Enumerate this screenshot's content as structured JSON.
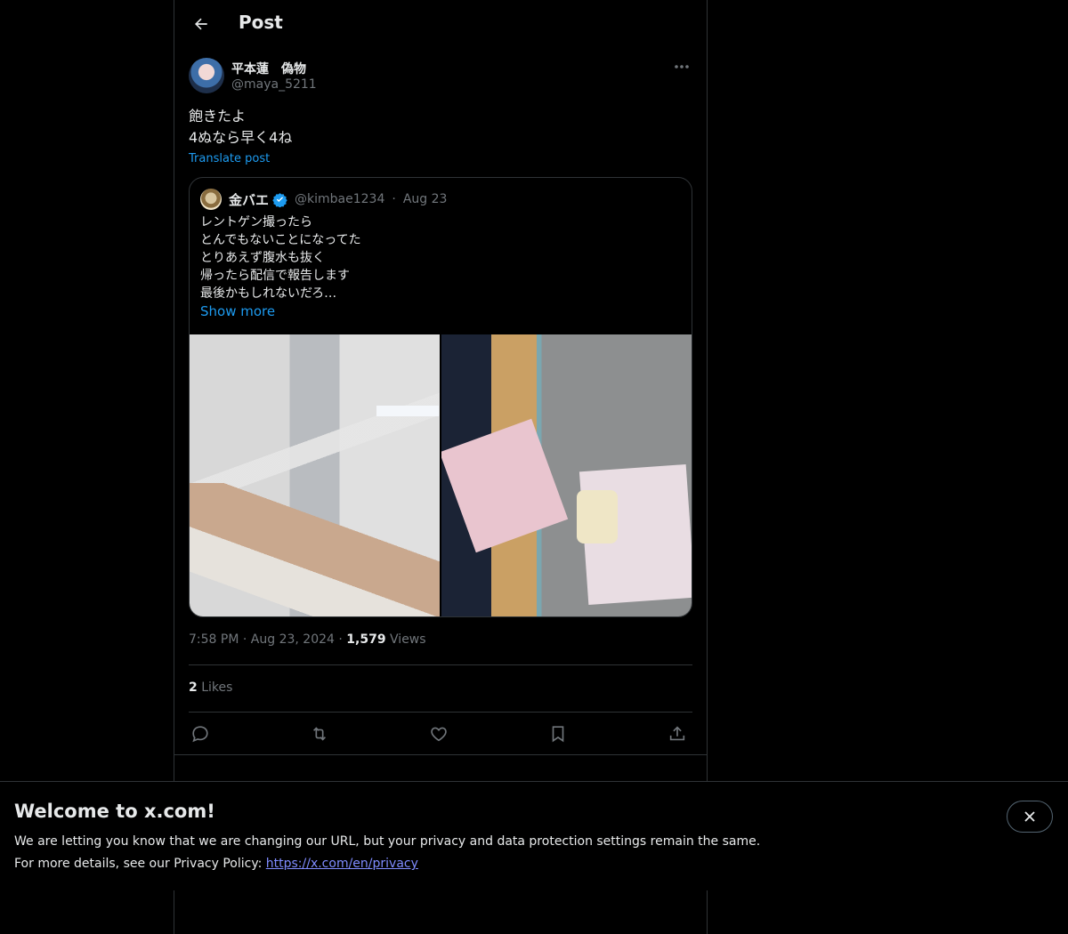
{
  "header": {
    "title": "Post",
    "back_icon": "arrow-left-icon"
  },
  "post": {
    "author": {
      "name": "平本蓮　偽物",
      "handle": "@maya_5211"
    },
    "text_lines": [
      "飽きたよ",
      "4ぬなら早く4ね"
    ],
    "translate_label": "Translate post",
    "quoted": {
      "name": "金バエ",
      "verified": true,
      "handle": "@kimbae1234",
      "separator": "·",
      "date": "Aug 23",
      "text_lines": [
        "レントゲン撮ったら",
        "とんでもないことになってた",
        "とりあえず腹水も抜く",
        "帰ったら配信で報告します",
        "最後かもしれないだろ…"
      ],
      "show_more": "Show more"
    },
    "time": "7:58 PM",
    "date": "Aug 23, 2024",
    "separator": "·",
    "views_count": "1,579",
    "views_label": "Views",
    "likes_count": "2",
    "likes_label": "Likes",
    "actions": [
      "reply-icon",
      "repost-icon",
      "like-icon",
      "bookmark-icon",
      "share-icon"
    ]
  },
  "banner": {
    "title": "Welcome to x.com!",
    "line1": "We are letting you know that we are changing our URL, but your privacy and data protection settings remain the same.",
    "line2_prefix": "For more details, see our Privacy Policy: ",
    "link": "https://x.com/en/privacy"
  },
  "colors": {
    "accent": "#1d9bf0",
    "muted": "#71767b",
    "border": "#2f3336",
    "background": "#000000"
  }
}
